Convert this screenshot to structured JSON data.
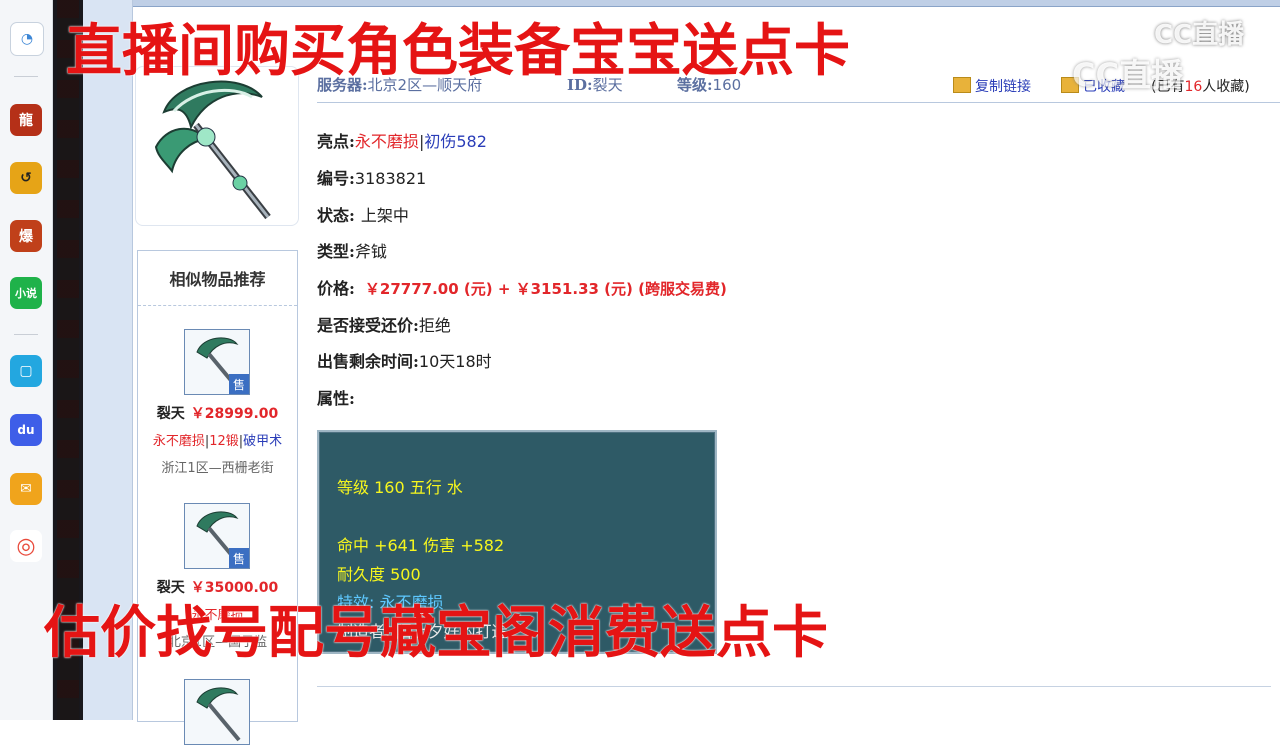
{
  "dock": {
    "icons": [
      {
        "name": "browser-icon",
        "glyph": "◔",
        "color": "#3d87d6"
      },
      {
        "name": "game-dragon-icon",
        "glyph": "龍",
        "color": "#b53018"
      },
      {
        "name": "game-arrow-icon",
        "glyph": "↺",
        "color": "#e6a417"
      },
      {
        "name": "game-blast-icon",
        "glyph": "爆",
        "color": "#c0401a"
      },
      {
        "name": "novel-icon",
        "glyph": "小说",
        "color": "#1fb24a"
      },
      {
        "name": "bilibili-icon",
        "glyph": "▢",
        "color": "#23a7e0"
      },
      {
        "name": "baidu-icon",
        "glyph": "du",
        "color": "#3e5ee8"
      },
      {
        "name": "mail-icon",
        "glyph": "✉",
        "color": "#f0a41c"
      },
      {
        "name": "netease-icon",
        "glyph": "◎",
        "color": "#e94a3b"
      }
    ]
  },
  "overlay": {
    "top_banner": "直播间购买角色装备宝宝送点卡",
    "bottom_banner": "估价找号配号藏宝阁消费送点卡"
  },
  "watermark": {
    "top": "CC直播",
    "mid": "CC直播"
  },
  "item": {
    "server_label": "服务器:",
    "server_value": "北京2区—顺天府",
    "id_label": "ID:",
    "id_value": "裂天",
    "level_label": "等级:",
    "level_value": "160",
    "copy_link": "复制链接",
    "favorite": "已收藏",
    "fav_count_prefix": "(已有",
    "fav_count": "16",
    "fav_count_suffix": "人收藏)",
    "highlight_label": "亮点:",
    "highlight_red": "永不磨损",
    "highlight_blue": "初伤582",
    "number_label": "编号:",
    "number_value": "3183821",
    "status_label": "状态:",
    "status_value": "上架中",
    "type_label": "类型:",
    "type_value": "斧钺",
    "price_label": "价格:",
    "price_value": "￥27777.00 (元)  +  ￥3151.33 (元) (跨服交易费)",
    "bargain_label": "是否接受还价:",
    "bargain_value": "拒绝",
    "remain_label": "出售剩余时间:",
    "remain_value": "10天18时",
    "attr_label": "属性:"
  },
  "attributes": {
    "line1": "等级 160  五行 水",
    "line2": "命中 +641  伤害 +582",
    "line3": "耐久度 500",
    "line4": "特效: 永不磨损",
    "line5": "制造者: 陌上夕好的打造"
  },
  "sidebar": {
    "title": "相似物品推荐",
    "items": [
      {
        "name": "裂天",
        "price": "￥28999.00",
        "tag1": "永不磨损",
        "tag2": "12锻",
        "tag3": "破甲术",
        "server": "浙江1区—西栅老街",
        "badge": "售"
      },
      {
        "name": "裂天",
        "price": "￥35000.00",
        "tag1": "永不磨损",
        "tag2": "",
        "tag3": "",
        "server": "北京1区—国子监",
        "badge": "售"
      }
    ]
  }
}
